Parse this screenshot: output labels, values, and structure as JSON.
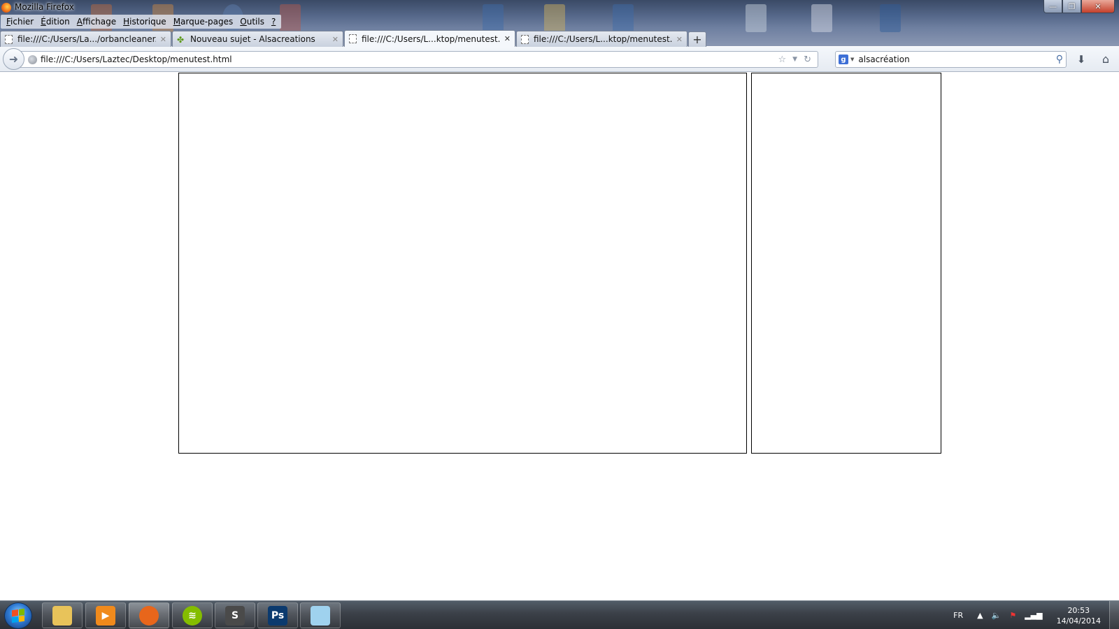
{
  "window": {
    "title": "Mozilla Firefox",
    "controls": {
      "minimize": "—",
      "maximize": "❐",
      "close": "✕"
    }
  },
  "menubar": [
    {
      "accel": "F",
      "rest": "ichier"
    },
    {
      "accel": "É",
      "rest": "dition"
    },
    {
      "accel": "A",
      "rest": "ffichage"
    },
    {
      "accel": "H",
      "rest": "istorique"
    },
    {
      "accel": "M",
      "rest": "arque-pages"
    },
    {
      "accel": "O",
      "rest": "utils"
    },
    {
      "accel": "?",
      "rest": ""
    }
  ],
  "tabs": [
    {
      "label": "file:///C:/Users/La.../orbancleaner.html",
      "active": false,
      "favicon": "blank-page-icon"
    },
    {
      "label": "Nouveau sujet - Alsacreations",
      "active": false,
      "favicon": "alsacreations-icon"
    },
    {
      "label": "file:///C:/Users/L...ktop/menutest.html",
      "active": true,
      "favicon": "blank-page-icon"
    },
    {
      "label": "file:///C:/Users/L...ktop/menutest.html",
      "active": false,
      "favicon": "blank-page-icon"
    }
  ],
  "navbar": {
    "url": "file:///C:/Users/Laztec/Desktop/menutest.html",
    "search_engine": "Google",
    "search_value": "alsacréation"
  },
  "taskbar": {
    "apps": [
      {
        "name": "Explorateur Windows",
        "icon": "folder-icon",
        "glyph": "",
        "color": "#e8c35a"
      },
      {
        "name": "Lecteur multimédia",
        "icon": "media-player-icon",
        "glyph": "▶",
        "color": "#f08a1c"
      },
      {
        "name": "Mozilla Firefox",
        "icon": "firefox-icon",
        "glyph": "",
        "color": "#e8661b",
        "active": true
      },
      {
        "name": "Spotify",
        "icon": "spotify-icon",
        "glyph": "≋",
        "color": "#84bd00"
      },
      {
        "name": "Sublime Text",
        "icon": "sublime-text-icon",
        "glyph": "S",
        "color": "#4a4a4a"
      },
      {
        "name": "Photoshop",
        "icon": "photoshop-icon",
        "glyph": "Ps",
        "color": "#0b3a6e"
      },
      {
        "name": "Notes",
        "icon": "notes-icon",
        "glyph": "",
        "color": "#9fd2ee"
      }
    ],
    "tray": {
      "language": "FR",
      "time": "20:53",
      "date": "14/04/2014"
    }
  }
}
